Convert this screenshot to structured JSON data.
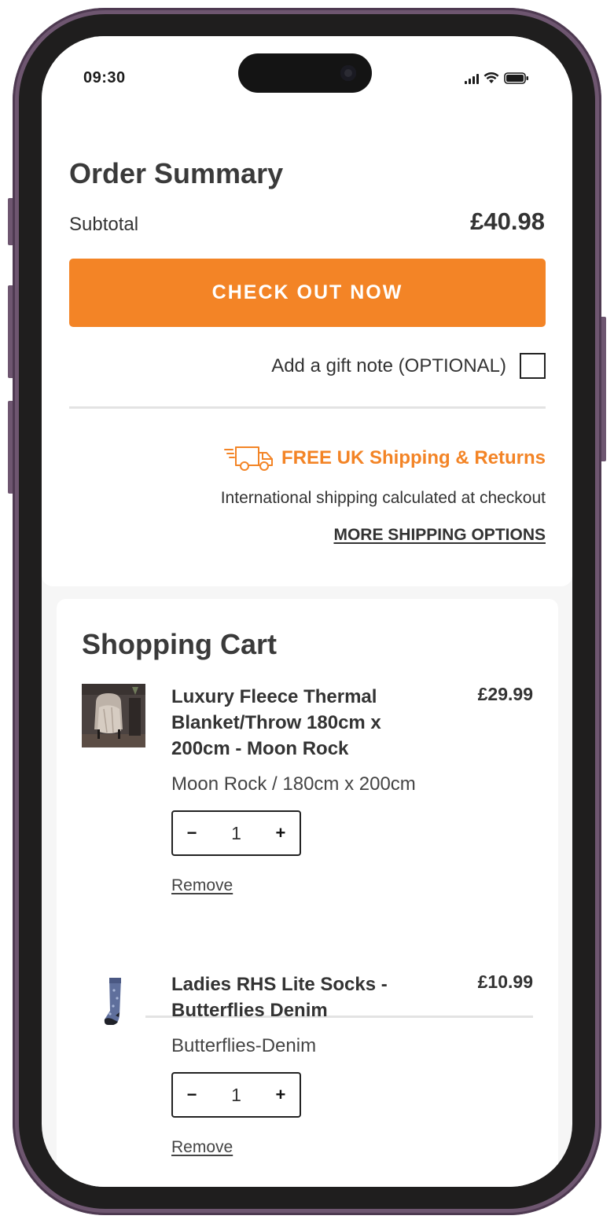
{
  "status_bar": {
    "time": "09:30"
  },
  "order_summary": {
    "title": "Order Summary",
    "subtotal_label": "Subtotal",
    "subtotal_value": "£40.98",
    "checkout_label": "CHECK OUT NOW",
    "gift_note_label": "Add a gift note (OPTIONAL)",
    "gift_note_checked": false,
    "shipping_title": "FREE UK Shipping & Returns",
    "international_text": "International shipping calculated at checkout",
    "more_shipping_label": "MORE SHIPPING OPTIONS",
    "accent_color": "#f38426"
  },
  "cart": {
    "title": "Shopping Cart",
    "items": [
      {
        "name": "Luxury Fleece Thermal Blanket/Throw 180cm x 200cm - Moon Rock",
        "price": "£29.99",
        "variant": "Moon Rock / 180cm x 200cm",
        "quantity": "1",
        "decrement": "−",
        "increment": "+",
        "remove_label": "Remove",
        "thumbnail_icon": "blanket-chair-photo"
      },
      {
        "name": "Ladies RHS Lite Socks - Butterflies Denim",
        "price": "£10.99",
        "variant": "Butterflies-Denim",
        "quantity": "1",
        "decrement": "−",
        "increment": "+",
        "remove_label": "Remove",
        "thumbnail_icon": "sock-photo"
      }
    ]
  }
}
